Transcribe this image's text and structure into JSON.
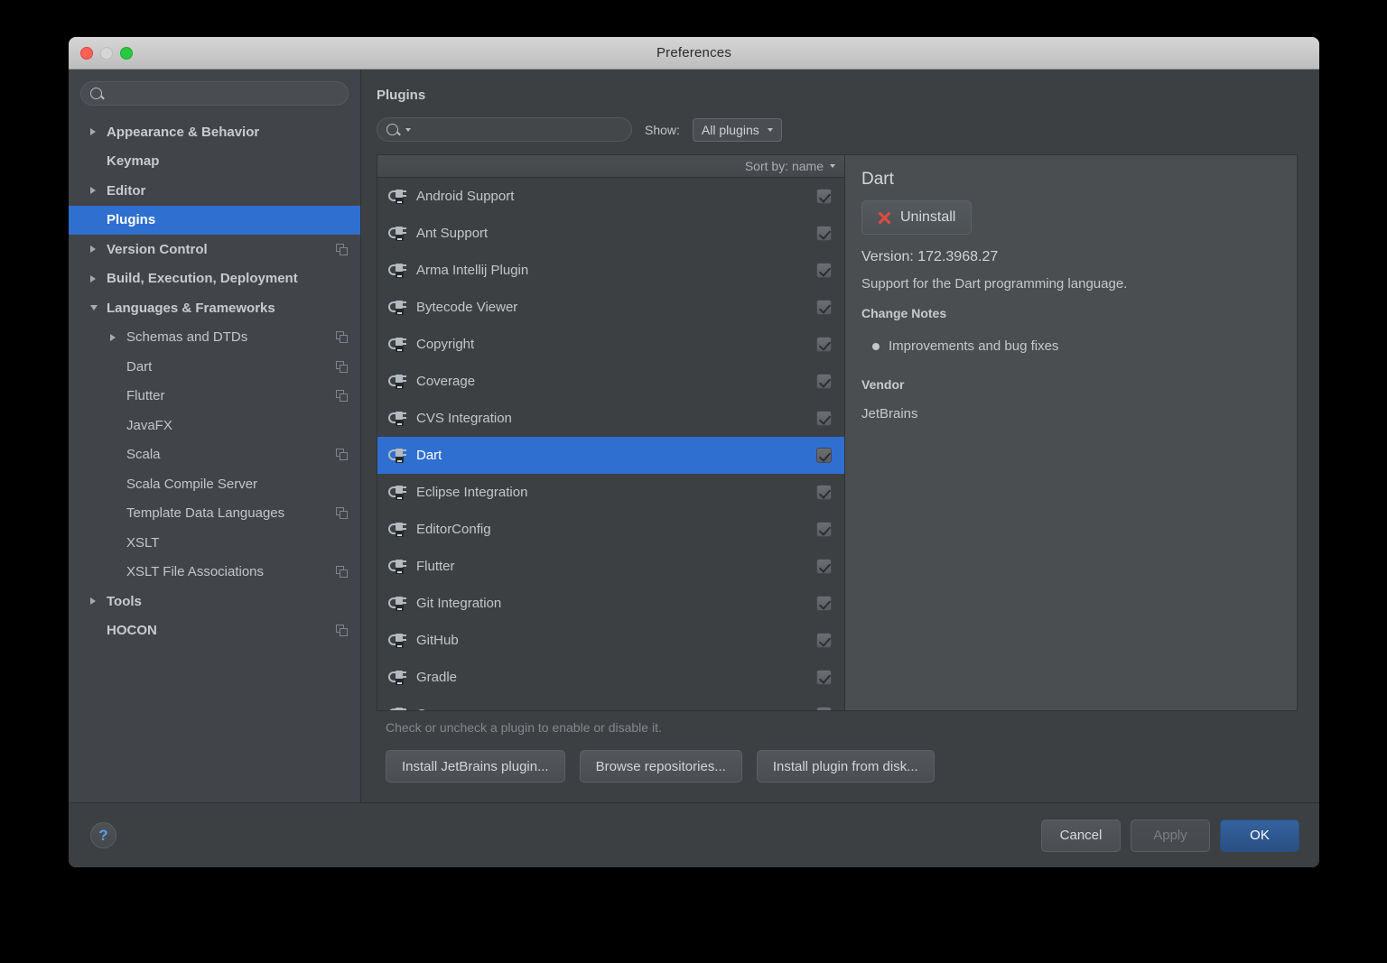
{
  "window": {
    "title": "Preferences",
    "traffic_lights": [
      "close",
      "minimize",
      "zoom"
    ]
  },
  "sidebar": {
    "search": {
      "value": "",
      "placeholder": ""
    },
    "items": [
      {
        "label": "Appearance & Behavior",
        "level": 0,
        "bold": true,
        "arrow": "right",
        "copy": false,
        "selected": false
      },
      {
        "label": "Keymap",
        "level": 0,
        "bold": true,
        "arrow": "none",
        "copy": false,
        "selected": false
      },
      {
        "label": "Editor",
        "level": 0,
        "bold": true,
        "arrow": "right",
        "copy": false,
        "selected": false
      },
      {
        "label": "Plugins",
        "level": 0,
        "bold": true,
        "arrow": "none",
        "copy": false,
        "selected": true
      },
      {
        "label": "Version Control",
        "level": 0,
        "bold": true,
        "arrow": "right",
        "copy": true,
        "selected": false
      },
      {
        "label": "Build, Execution, Deployment",
        "level": 0,
        "bold": true,
        "arrow": "right",
        "copy": false,
        "selected": false
      },
      {
        "label": "Languages & Frameworks",
        "level": 0,
        "bold": true,
        "arrow": "down",
        "copy": false,
        "selected": false
      },
      {
        "label": "Schemas and DTDs",
        "level": 1,
        "bold": false,
        "arrow": "right",
        "copy": true,
        "selected": false
      },
      {
        "label": "Dart",
        "level": 1,
        "bold": false,
        "arrow": "none",
        "copy": true,
        "selected": false
      },
      {
        "label": "Flutter",
        "level": 1,
        "bold": false,
        "arrow": "none",
        "copy": true,
        "selected": false
      },
      {
        "label": "JavaFX",
        "level": 1,
        "bold": false,
        "arrow": "none",
        "copy": false,
        "selected": false
      },
      {
        "label": "Scala",
        "level": 1,
        "bold": false,
        "arrow": "none",
        "copy": true,
        "selected": false
      },
      {
        "label": "Scala Compile Server",
        "level": 1,
        "bold": false,
        "arrow": "none",
        "copy": false,
        "selected": false
      },
      {
        "label": "Template Data Languages",
        "level": 1,
        "bold": false,
        "arrow": "none",
        "copy": true,
        "selected": false
      },
      {
        "label": "XSLT",
        "level": 1,
        "bold": false,
        "arrow": "none",
        "copy": false,
        "selected": false
      },
      {
        "label": "XSLT File Associations",
        "level": 1,
        "bold": false,
        "arrow": "none",
        "copy": true,
        "selected": false
      },
      {
        "label": "Tools",
        "level": 0,
        "bold": true,
        "arrow": "right",
        "copy": false,
        "selected": false
      },
      {
        "label": "HOCON",
        "level": 0,
        "bold": true,
        "arrow": "none",
        "copy": true,
        "selected": false
      }
    ]
  },
  "main": {
    "title": "Plugins",
    "search": {
      "value": "",
      "placeholder": ""
    },
    "show_label": "Show:",
    "show_value": "All plugins",
    "sort_label": "Sort by: name",
    "hint": "Check or uncheck a plugin to enable or disable it.",
    "buttons": [
      "Install JetBrains plugin...",
      "Browse repositories...",
      "Install plugin from disk..."
    ],
    "plugins": [
      {
        "name": "Android Support",
        "checked": true,
        "selected": false
      },
      {
        "name": "Ant Support",
        "checked": true,
        "selected": false
      },
      {
        "name": "Arma Intellij Plugin",
        "checked": true,
        "selected": false
      },
      {
        "name": "Bytecode Viewer",
        "checked": true,
        "selected": false
      },
      {
        "name": "Copyright",
        "checked": true,
        "selected": false
      },
      {
        "name": "Coverage",
        "checked": true,
        "selected": false
      },
      {
        "name": "CVS Integration",
        "checked": true,
        "selected": false
      },
      {
        "name": "Dart",
        "checked": true,
        "selected": true
      },
      {
        "name": "Eclipse Integration",
        "checked": true,
        "selected": false
      },
      {
        "name": "EditorConfig",
        "checked": true,
        "selected": false
      },
      {
        "name": "Flutter",
        "checked": true,
        "selected": false
      },
      {
        "name": "Git Integration",
        "checked": true,
        "selected": false
      },
      {
        "name": "GitHub",
        "checked": true,
        "selected": false
      },
      {
        "name": "Gradle",
        "checked": true,
        "selected": false
      },
      {
        "name": "Groovy",
        "checked": true,
        "selected": false
      }
    ]
  },
  "details": {
    "title": "Dart",
    "uninstall_label": "Uninstall",
    "version": "Version: 172.3968.27",
    "description": "Support for the Dart programming language.",
    "change_notes_header": "Change Notes",
    "change_notes": "Improvements and bug fixes",
    "vendor_header": "Vendor",
    "vendor": "JetBrains"
  },
  "footer": {
    "help_label": "?",
    "cancel_label": "Cancel",
    "apply_label": "Apply",
    "ok_label": "OK"
  },
  "colors": {
    "accent_selection": "#2f6fd0",
    "window_bg": "#3c4043",
    "sidebar_bg": "#41454a",
    "details_bg": "#4a4e51",
    "titlebar_bg": "#c8c8c8",
    "ok_button": "#35629f",
    "uninstall_x": "#e04c3f",
    "help_glyph": "#5d9cea"
  }
}
